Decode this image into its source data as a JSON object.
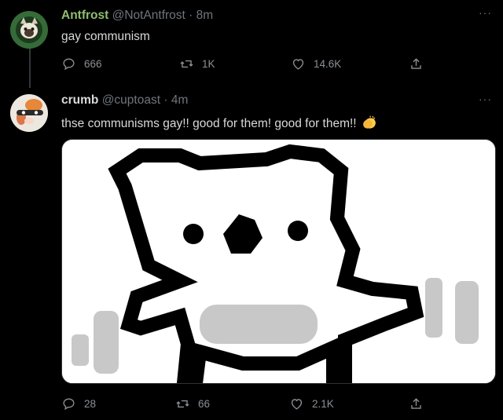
{
  "tweets": [
    {
      "display_name": "Antfrost",
      "handle": "@NotAntfrost",
      "separator": "·",
      "time": "8m",
      "text": "gay communism",
      "name_color": "#8fbf6f",
      "replies": "666",
      "retweets": "1K",
      "likes": "14.6K",
      "more": "···"
    },
    {
      "display_name": "crumb",
      "handle": "@cuptoast",
      "separator": "·",
      "time": "4m",
      "text": "thse communisms gay!! good for them! good for them!!",
      "emoji": "clapping-hands-icon",
      "name_color": "#d9d9d9",
      "replies": "28",
      "retweets": "66",
      "likes": "2.1K",
      "more": "···",
      "media": "pixel-art-bear-image"
    }
  ],
  "colors": {
    "background": "#000000",
    "text": "#d9d9d9",
    "muted": "#6e767d",
    "thread_line": "#333639"
  }
}
